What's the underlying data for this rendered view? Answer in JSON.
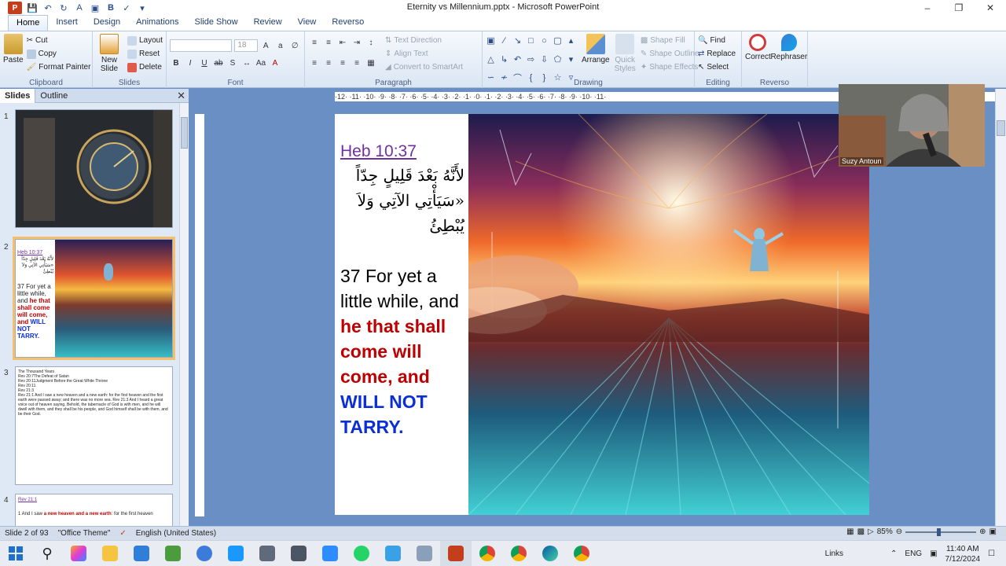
{
  "window": {
    "title": "Eternity vs Millennium.pptx - Microsoft PowerPoint",
    "logo": "P",
    "controls": [
      "–",
      "❐",
      "✕"
    ]
  },
  "ribbon": {
    "tabs": [
      "Home",
      "Insert",
      "Design",
      "Animations",
      "Slide Show",
      "Review",
      "View",
      "Reverso"
    ],
    "active_tab": "Home",
    "clipboard": {
      "label": "Clipboard",
      "paste": "Paste",
      "cut": "Cut",
      "copy": "Copy",
      "format_painter": "Format Painter"
    },
    "slides": {
      "label": "Slides",
      "new_slide": "New Slide",
      "layout": "Layout",
      "reset": "Reset",
      "delete": "Delete"
    },
    "font": {
      "label": "Font",
      "font_size": "18"
    },
    "paragraph": {
      "label": "Paragraph",
      "text_direction": "Text Direction",
      "align_text": "Align Text",
      "convert_smartart": "Convert to SmartArt"
    },
    "drawing": {
      "label": "Drawing",
      "arrange": "Arrange",
      "quick_styles": "Quick Styles",
      "shape_fill": "Shape Fill",
      "shape_outline": "Shape Outline",
      "shape_effects": "Shape Effects"
    },
    "editing": {
      "label": "Editing",
      "find": "Find",
      "replace": "Replace",
      "select": "Select"
    },
    "reverso": {
      "label": "Reverso",
      "correct": "Correct",
      "rephraser": "Rephraser"
    }
  },
  "pane": {
    "tabs": [
      "Slides",
      "Outline"
    ],
    "active_tab": "Slides",
    "slide_numbers": [
      "1",
      "2",
      "3",
      "4"
    ],
    "thumb2": {
      "ref": "Heb 10:37",
      "arabic": "لأَنَّهُ بَعْدَ قَلِيلٍ جِدّاً «سَيَأْتِي الآتِي وَلاَ يُبْطِئُ",
      "t1": "37 For yet a little while, and ",
      "t2": "he that shall come will come, and ",
      "t3": "WILL NOT TARRY."
    },
    "thumb3": {
      "lines": [
        "The Thousand Years",
        "Rev 20:7The Defeat of Satan",
        "Rev 20:11Judgment Before the Great White Throne",
        "Rev 20:11",
        "Rev 21:3",
        "Rev 21:1 And I saw a new heaven and a new earth: for the first heaven and the first earth were passed away; and there was no more sea. Rev 21:3 And I heard a great voice out of heaven saying, Behold, the tabernacle of God is with men, and he will dwell with them, and they shall be his people, and God himself shall be with them, and be their God."
      ]
    },
    "thumb4": {
      "ref": "Rev 21:1",
      "text1": "1 And I saw ",
      "text2": "a new heaven and a new earth",
      "text3": ": for the first heaven"
    }
  },
  "slide": {
    "ref": "Heb 10:37",
    "arabic_line1": "لأَنَّهُ بَعْدَ قَلِيلٍ جِدّاً",
    "arabic_line2": "«سَيَأْتِي الآتِي وَلاَ",
    "arabic_line3": "يُبْطِئُ",
    "verse_plain": "37  For yet a little while, and ",
    "verse_red": "he that shall come will come, and ",
    "verse_blue": "WILL NOT TARRY."
  },
  "ruler": {
    "marks": "·12· ·11· ·10· ·9· ·8· ·7· ·6· ·5· ·4· ·3· ·2· ·1· ·0· ·1· ·2· ·3· ·4· ·5· ·6· ·7· ·8· ·9· ·10· ·11·"
  },
  "webcam": {
    "name": "Suzy Antoun"
  },
  "status": {
    "slide": "Slide 2 of 93",
    "theme": "\"Office Theme\"",
    "language": "English (United States)",
    "zoom": "85%"
  },
  "taskbar": {
    "links": "Links",
    "lang": "ENG",
    "time": "11:40 AM",
    "date": "7/12/2024"
  },
  "colors": {
    "accent": "#2b579a",
    "verse_red": "#c00000",
    "verse_blue": "#0b2fd6",
    "ref_purple": "#7030a0"
  }
}
